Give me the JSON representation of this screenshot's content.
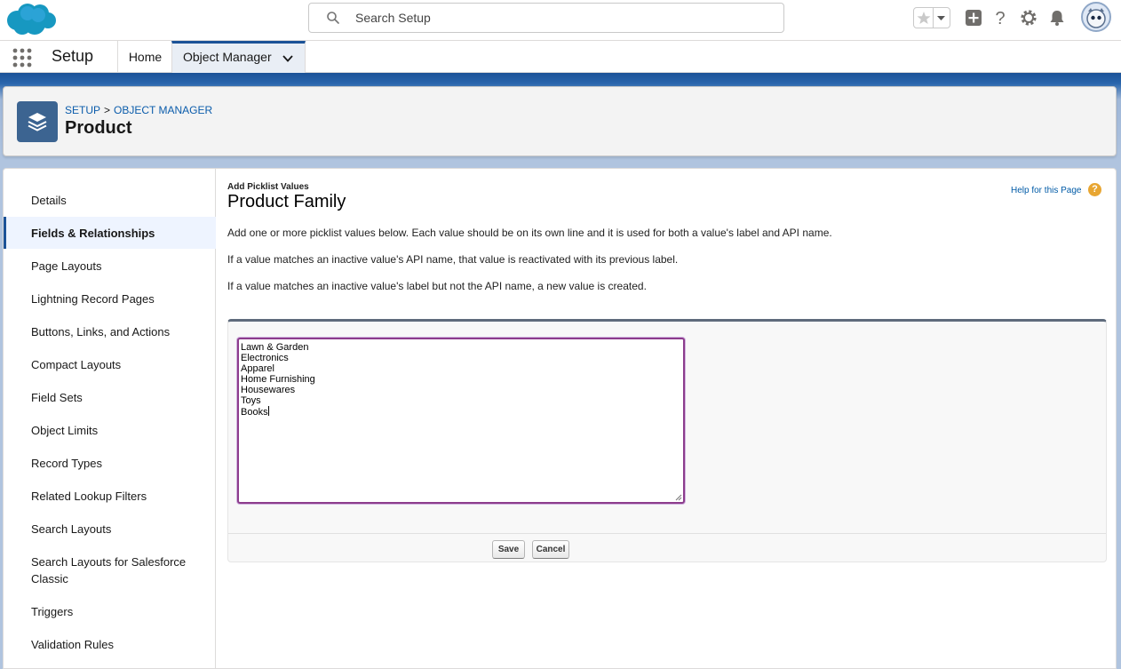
{
  "header": {
    "search_placeholder": "Search Setup",
    "icons": [
      "salesforce-cloud-logo",
      "star-icon",
      "add-icon",
      "help-icon",
      "gear-icon",
      "bell-icon",
      "avatar"
    ]
  },
  "context_bar": {
    "app_name": "Setup",
    "tabs": [
      {
        "label": "Home"
      },
      {
        "label": "Object Manager"
      }
    ]
  },
  "page_header": {
    "breadcrumb": [
      "SETUP",
      "OBJECT MANAGER"
    ],
    "breadcrumb_separator": ">",
    "title": "Product"
  },
  "sidebar": {
    "items": [
      {
        "label": "Details"
      },
      {
        "label": "Fields & Relationships"
      },
      {
        "label": "Page Layouts"
      },
      {
        "label": "Lightning Record Pages"
      },
      {
        "label": "Buttons, Links, and Actions"
      },
      {
        "label": "Compact Layouts"
      },
      {
        "label": "Field Sets"
      },
      {
        "label": "Object Limits"
      },
      {
        "label": "Record Types"
      },
      {
        "label": "Related Lookup Filters"
      },
      {
        "label": "Search Layouts"
      },
      {
        "label": "Search Layouts for Salesforce Classic"
      },
      {
        "label": "Triggers"
      },
      {
        "label": "Validation Rules"
      }
    ],
    "active": "Fields & Relationships"
  },
  "content": {
    "eyebrow": "Add Picklist Values",
    "title": "Product Family",
    "help_link": "Help for this Page",
    "paragraphs": [
      "Add one or more picklist values below. Each value should be on its own line and it is used for both a value's label and API name.",
      "If a value matches an inactive value's API name, that value is reactivated with its previous label.",
      "If a value matches an inactive value's label but not the API name, a new value is created."
    ],
    "picklist_values": [
      "Lawn & Garden",
      "Electronics",
      "Apparel",
      "Home Furnishing",
      "Housewares",
      "Toys",
      "Books"
    ],
    "save_label": "Save",
    "cancel_label": "Cancel"
  },
  "colors": {
    "brand_blue": "#1b5297",
    "link": "#0b5cab",
    "textarea_focus": "#8c3c8c",
    "help_orange": "#e8a632"
  }
}
